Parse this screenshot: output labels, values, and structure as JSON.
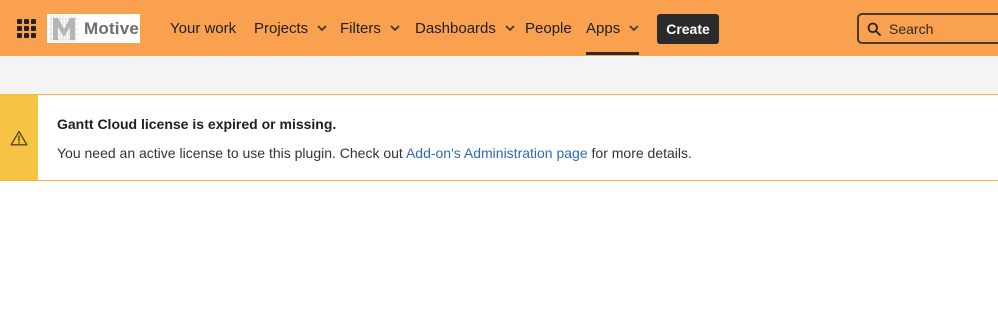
{
  "header": {
    "logo_text": "Motive",
    "nav": [
      {
        "label": "Your work",
        "has_dropdown": false
      },
      {
        "label": "Projects",
        "has_dropdown": true
      },
      {
        "label": "Filters",
        "has_dropdown": true
      },
      {
        "label": "Dashboards",
        "has_dropdown": true
      },
      {
        "label": "People",
        "has_dropdown": false
      },
      {
        "label": "Apps",
        "has_dropdown": true,
        "active": true
      }
    ],
    "create_label": "Create",
    "search_placeholder": "Search",
    "background_color": "#f9a14f"
  },
  "alert": {
    "type": "warning",
    "title": "Gantt Cloud license is expired or missing.",
    "body_before": "You need an active license to use this plugin. Check out ",
    "link_text": "Add-on's Administration page",
    "body_after": " for more details.",
    "accent_color": "#f6c344",
    "link_color": "#2e6bb8",
    "icon": "warning-icon"
  }
}
